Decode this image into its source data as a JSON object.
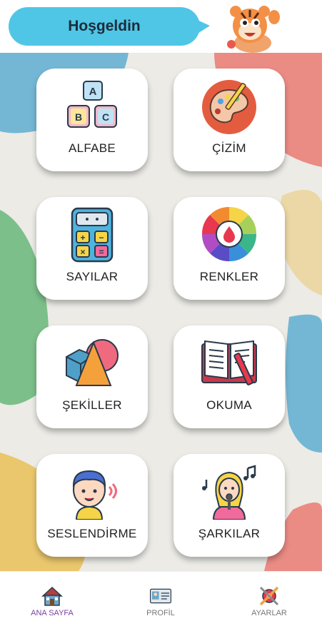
{
  "header": {
    "greeting": "Hoşgeldin"
  },
  "cards": [
    {
      "label": "ALFABE",
      "icon": "abc-blocks-icon"
    },
    {
      "label": "ÇİZİM",
      "icon": "paint-palette-icon"
    },
    {
      "label": "SAYILAR",
      "icon": "calculator-icon"
    },
    {
      "label": "RENKLER",
      "icon": "color-wheel-icon"
    },
    {
      "label": "ŞEKİLLER",
      "icon": "shapes-icon"
    },
    {
      "label": "OKUMA",
      "icon": "book-icon"
    },
    {
      "label": "SESLENDİRME",
      "icon": "speaking-boy-icon"
    },
    {
      "label": "ŞARKILAR",
      "icon": "singing-girl-icon"
    }
  ],
  "nav": [
    {
      "label": "ANA SAYFA",
      "icon": "home-icon",
      "active": true
    },
    {
      "label": "PROFİL",
      "icon": "profile-card-icon",
      "active": false
    },
    {
      "label": "AYARLAR",
      "icon": "settings-tools-icon",
      "active": false
    }
  ],
  "colors": {
    "bubble": "#4fc6e6",
    "active_nav": "#7b3fa0",
    "background": "#ecebe6"
  }
}
